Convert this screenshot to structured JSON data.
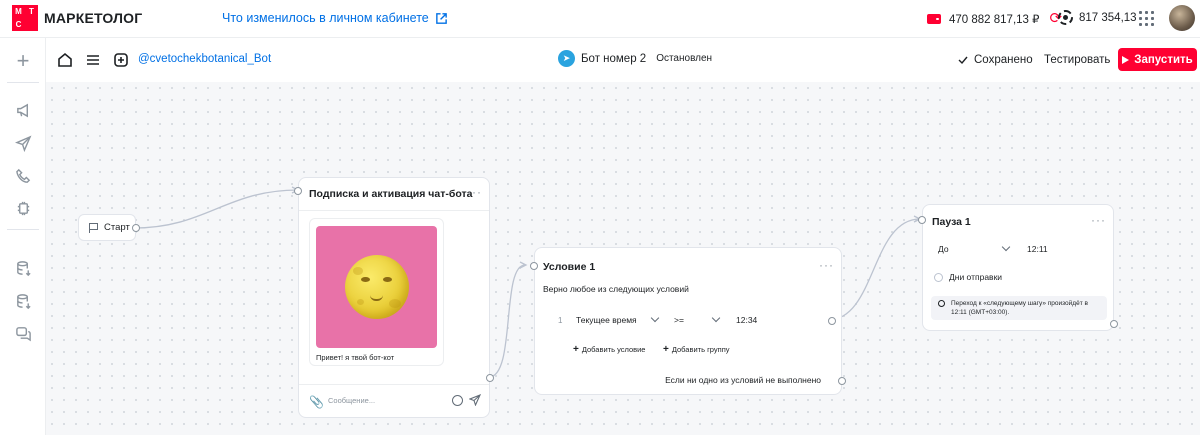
{
  "header": {
    "logo_letters": [
      "М",
      "Т",
      "С",
      ""
    ],
    "brand": "МАРКЕТОЛОГ",
    "whats_new": "Что изменилось в личном кабинете",
    "balance": "470 882 817,13 ₽",
    "bonus": "817 354,13",
    "accent_color": "#ff0032",
    "link_color": "#0070e5"
  },
  "sidebar": {
    "items": [
      {
        "icon": "plus-icon"
      },
      {
        "icon": "megaphone-icon"
      },
      {
        "icon": "paper-plane-icon"
      },
      {
        "icon": "phone-icon"
      },
      {
        "icon": "chip-icon"
      },
      {
        "icon": "database-download-icon"
      },
      {
        "icon": "database-check-icon"
      },
      {
        "icon": "chat-icon"
      }
    ]
  },
  "toolbar": {
    "bot_handle": "@cvetochekbotanical_Bot",
    "bot_name": "Бот номер 2",
    "bot_status": "Остановлен",
    "saved_label": "Сохранено",
    "test_label": "Тестировать",
    "run_label": "Запустить"
  },
  "nodes": {
    "start": {
      "label": "Старт"
    },
    "subscription": {
      "title": "Подписка и активация чат-бота",
      "message_text": "Привет! я твой бот-кот",
      "input_placeholder": "Сообщение..."
    },
    "condition": {
      "title": "Условие 1",
      "subtitle": "Верно любое из следующих условий",
      "row": {
        "index": "1",
        "field": "Текущее время",
        "operator": ">=",
        "value": "12:34"
      },
      "add_condition": "Добавить условие",
      "add_group": "Добавить группу",
      "else_text": "Если ни одно из условий не выполнено"
    },
    "pause": {
      "title": "Пауза 1",
      "mode": "До",
      "time": "12:11",
      "days_label": "Дни отправки",
      "info": "Переход к «следующему шагу» произойдёт в 12:11 (GMT+03:00)."
    }
  }
}
